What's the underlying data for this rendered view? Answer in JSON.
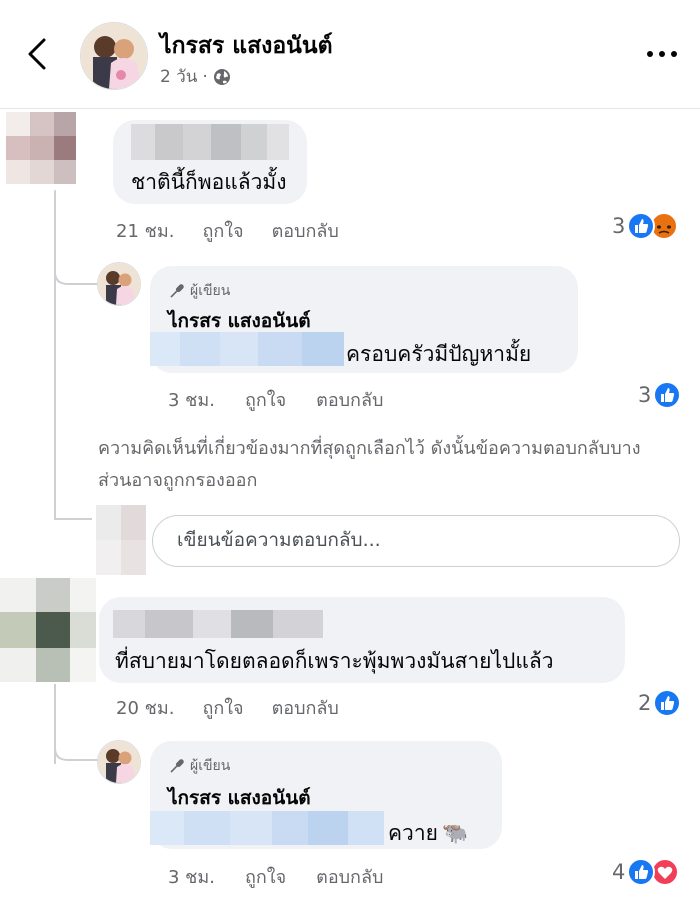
{
  "header": {
    "name": "ไกรสร แสงอนันต์",
    "time": "2 วัน",
    "separator": "·",
    "privacy_icon": "globe-icon"
  },
  "comment1": {
    "text": "ชาตินี้ก็พอแล้วมั้ง",
    "time": "21 ชม.",
    "like_label": "ถูกใจ",
    "reply_label": "ตอบกลับ",
    "reaction_count": "3",
    "reactions": [
      "like",
      "angry"
    ]
  },
  "reply1": {
    "badge": "ผู้เขียน",
    "name": "ไกรสร แสงอนันต์",
    "text": "ครอบครัวมีปัญหามั้ย",
    "time": "3 ชม.",
    "like_label": "ถูกใจ",
    "reply_label": "ตอบกลับ",
    "reaction_count": "3",
    "reactions": [
      "like"
    ]
  },
  "notice": "ความคิดเห็นที่เกี่ยวข้องมากที่สุดถูกเลือกไว้ ดังนั้นข้อความตอบกลับบางส่วนอาจถูกกรองออก",
  "reply_input": {
    "placeholder": "เขียนข้อความตอบกลับ..."
  },
  "comment2": {
    "text": "ที่สบายมาโดยตลอดก็เพราะพุ้มพวงมันสายไปแล้ว",
    "time": "20 ชม.",
    "like_label": "ถูกใจ",
    "reply_label": "ตอบกลับ",
    "reaction_count": "2",
    "reactions": [
      "like"
    ]
  },
  "reply2": {
    "badge": "ผู้เขียน",
    "name": "ไกรสร แสงอนันต์",
    "text": "ควาย",
    "emoji": "🐃",
    "time": "3 ชม.",
    "like_label": "ถูกใจ",
    "reply_label": "ตอบกลับ",
    "reaction_count": "4",
    "reactions": [
      "like",
      "love"
    ]
  },
  "colors": {
    "like": "#1877f2",
    "love": "#f33e58",
    "angry": "#e9710f",
    "bubble": "#f0f2f5",
    "secondary_text": "#65676b"
  }
}
